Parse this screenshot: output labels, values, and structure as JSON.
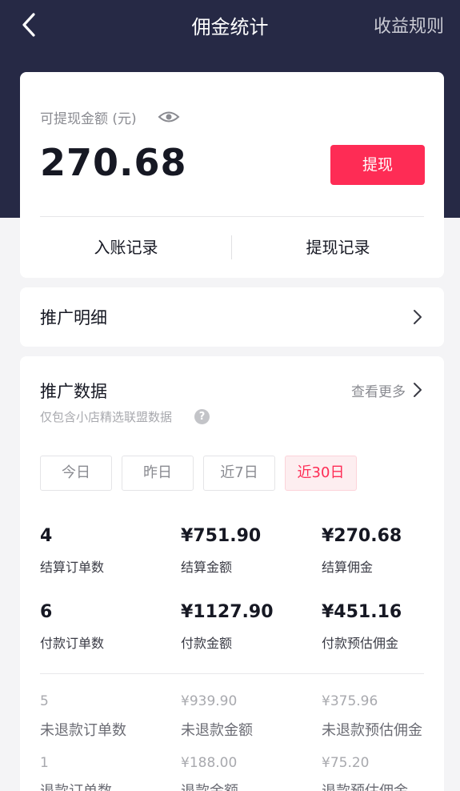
{
  "nav": {
    "title": "佣金统计",
    "rules": "收益规则"
  },
  "balance": {
    "label": "可提现金额 (元)",
    "amount": "270.68",
    "withdraw": "提现",
    "records": [
      "入账记录",
      "提现记录"
    ]
  },
  "detail": {
    "title": "推广明细"
  },
  "promo": {
    "title": "推广数据",
    "more": "查看更多",
    "note": "仅包含小店精选联盟数据",
    "help": "?",
    "tabs": [
      "今日",
      "昨日",
      "近7日",
      "近30日"
    ],
    "active_tab": "近30日",
    "stats": [
      {
        "value": "4",
        "label": "结算订单数"
      },
      {
        "value": "¥751.90",
        "label": "结算金额"
      },
      {
        "value": "¥270.68",
        "label": "结算佣金"
      },
      {
        "value": "6",
        "label": "付款订单数"
      },
      {
        "value": "¥1127.90",
        "label": "付款金额"
      },
      {
        "value": "¥451.16",
        "label": "付款预估佣金"
      }
    ],
    "sub_stats": [
      {
        "value": "5",
        "label": "未退款订单数"
      },
      {
        "value": "¥939.90",
        "label": "未退款金额"
      },
      {
        "value": "¥375.96",
        "label": "未退款预估佣金"
      },
      {
        "value": "1",
        "label": "退款订单数"
      },
      {
        "value": "¥188.00",
        "label": "退款金额"
      },
      {
        "value": "¥75.20",
        "label": "退款预估佣金"
      }
    ]
  },
  "colors": {
    "header": "#262945",
    "accent": "#fe2c55"
  }
}
